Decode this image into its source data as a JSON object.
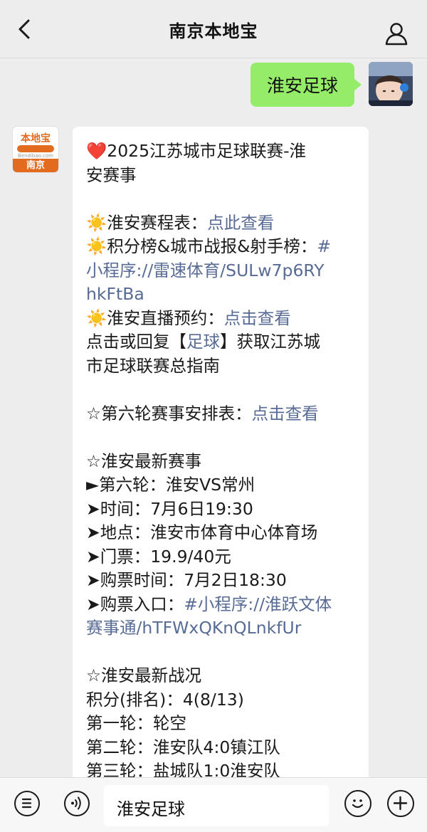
{
  "header": {
    "title": "南京本地宝"
  },
  "outgoing": {
    "text": "淮安足球"
  },
  "account": {
    "logo_text": "本地宝",
    "logo_url": "Bendibao.com",
    "logo_city": "南京"
  },
  "message": {
    "heart": "❤️",
    "title_line1": "2025江苏城市足球联赛-淮",
    "title_line2": "安赛事",
    "sun": "☀️",
    "schedule_label": "淮安赛程表：",
    "schedule_link": "点此查看",
    "standings_label": "积分榜&城市战报&射手榜：",
    "standings_link_line1": "#",
    "standings_link_line2": "小程序://雷速体育/SULw7p6RY",
    "standings_link_line3": "hkFtBa",
    "live_label": "淮安直播预约：",
    "live_link": "点击查看",
    "reply_pre": "点击或回复【",
    "reply_keyword": "足球",
    "reply_post_line1": "】获取江苏城",
    "reply_post_line2": "市足球联赛总指南",
    "round6_label": "☆第六轮赛事安排表：",
    "round6_link": "点击查看",
    "latest_title": "☆淮安最新赛事",
    "match": "►第六轮：淮安VS常州",
    "time": "➤时间：7月6日19:30",
    "venue": "➤地点：淮安市体育中心体育场",
    "ticket": "➤门票：19.9/40元",
    "sale_time": "➤购票时间：7月2日18:30",
    "entry_label": "➤购票入口：",
    "entry_link_line1": "#小程序://淮跃文体",
    "entry_link_line2": "赛事通/hTFWxQKnQLnkfUr",
    "status_title": "☆淮安最新战况",
    "points": "积分(排名)：4(8/13)",
    "round1": "第一轮：轮空",
    "round2": "第二轮：淮安队4:0镇江队",
    "round3": "第三轮：盐城队1:0淮安队"
  },
  "input": {
    "value": "淮安足球"
  },
  "icons": {
    "back": "chevron-left-icon",
    "profile": "person-icon",
    "menu": "menu-list-icon",
    "voice": "voice-icon",
    "emoji": "emoji-icon",
    "add": "plus-icon"
  }
}
